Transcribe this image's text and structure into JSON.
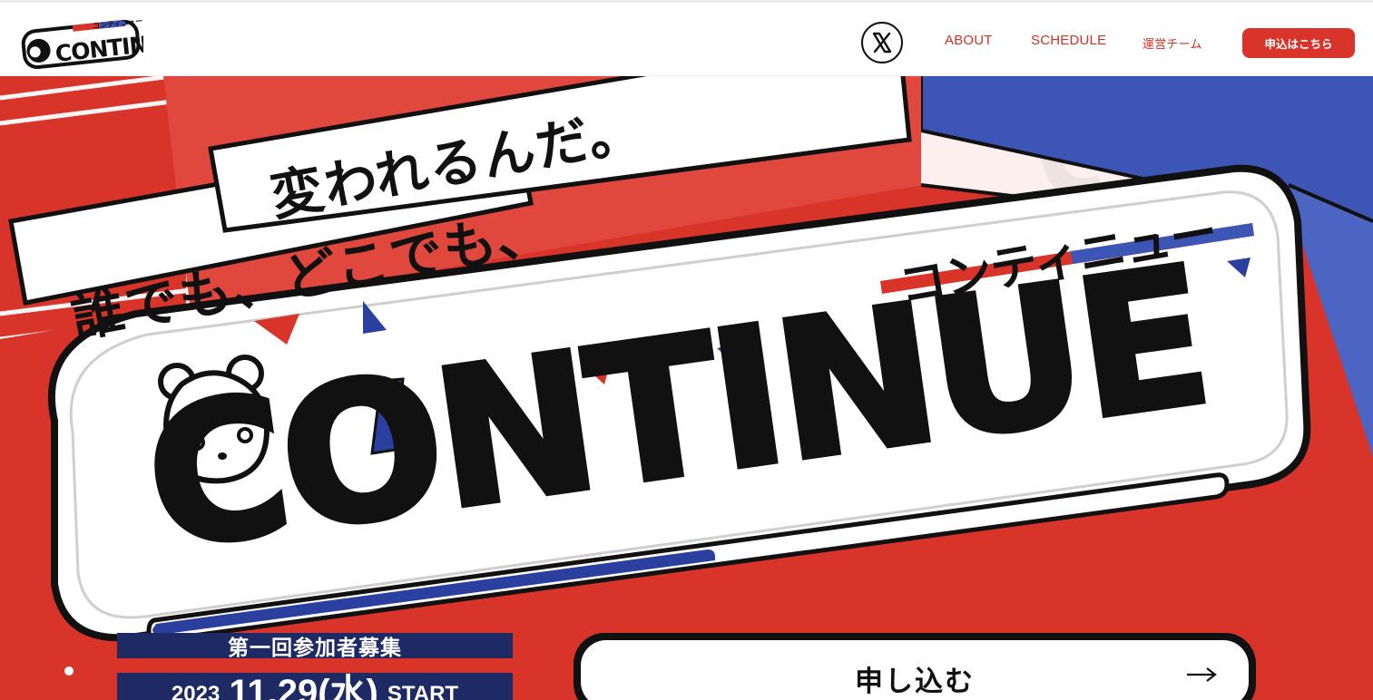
{
  "header": {
    "logo_text": "CONTINUE",
    "logo_subtext": "コンティニュー",
    "x_icon": "x-logo-icon",
    "nav": [
      {
        "label": "ABOUT"
      },
      {
        "label": "SCHEDULE"
      },
      {
        "label": "運営チーム"
      }
    ],
    "cta_label": "申込はこちら"
  },
  "hero": {
    "tagline_line1": "誰でも、どこでも、",
    "tagline_line2": "変われるんだ。",
    "tagline_full": "誰でも、どこでも、変われるんだ。",
    "katakana": "コンティニュー",
    "title": "CONTINUE",
    "recruit_label": "第一回参加者募集",
    "date_year": "2023",
    "date_md": "11.29(水)",
    "date_start": "START",
    "apply_label": "申し込む",
    "apply_arrow": "arrow-right-icon"
  },
  "colors": {
    "accent_red": "#d9342a",
    "navy": "#1d2a63",
    "blue": "#3d55b5",
    "pink_bg": "#fcefed"
  }
}
